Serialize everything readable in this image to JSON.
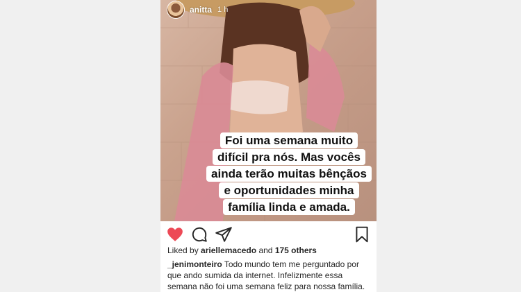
{
  "story": {
    "username": "anitta",
    "time": "1 h"
  },
  "overlay_text_lines": [
    "Foi uma semana muito",
    "difícil pra nós. Mas vocês",
    "ainda terão muitas bênçãos",
    "e oportunidades minha",
    "família linda e amada."
  ],
  "actions": {
    "like_icon": "heart-icon",
    "comment_icon": "comment-icon",
    "share_icon": "send-icon",
    "save_icon": "bookmark-icon",
    "like_color": "#ed4956"
  },
  "likes": {
    "prefix": "Liked by",
    "user": "ariellemacedo",
    "conj": "and",
    "others": "175 others"
  },
  "comment": {
    "handle": "_jenimonteiro",
    "text": "Todo mundo tem me perguntado por que ando sumida da internet. Infelizmente essa semana não foi uma semana feliz para nossa família."
  }
}
